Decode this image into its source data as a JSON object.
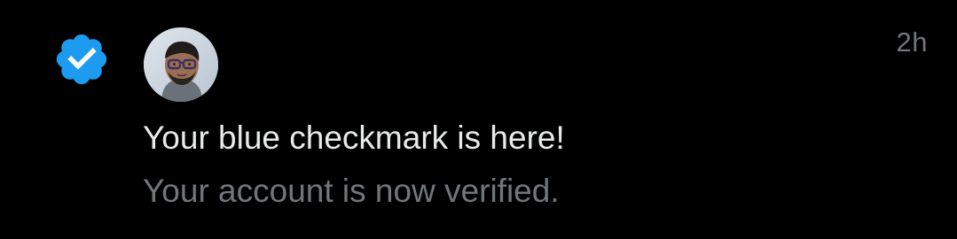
{
  "notification": {
    "icon": "verified-badge-icon",
    "avatar": "user-avatar",
    "timestamp": "2h",
    "title": "Your blue checkmark is here!",
    "subtitle": "Your account is now verified."
  },
  "colors": {
    "background": "#000000",
    "badge_blue": "#1d9bf0",
    "text_primary": "#e7e9ea",
    "text_secondary": "#71767b"
  }
}
